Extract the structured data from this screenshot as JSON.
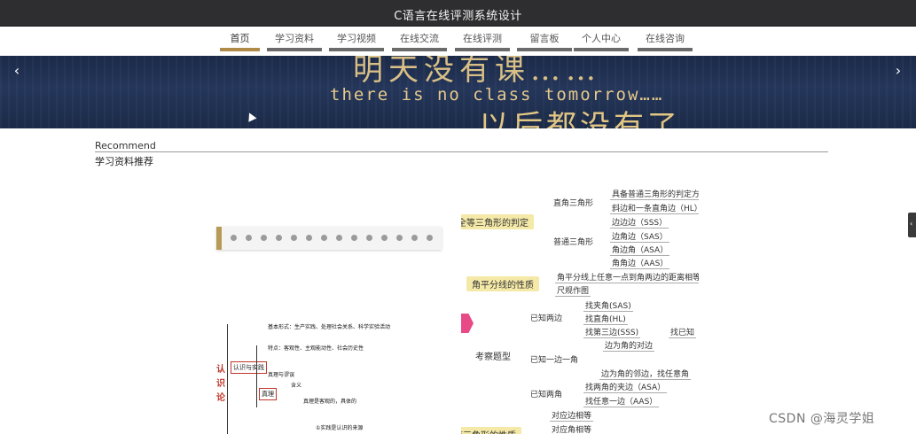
{
  "app": {
    "title": "C语言在线评测系统设计"
  },
  "nav": {
    "tabs": [
      {
        "label": "首页",
        "active": true
      },
      {
        "label": "学习资料",
        "active": false
      },
      {
        "label": "学习视频",
        "active": false
      },
      {
        "label": "在线交流",
        "active": false
      },
      {
        "label": "在线评测",
        "active": false
      },
      {
        "label": "留言板",
        "active": false
      },
      {
        "label": "个人中心",
        "active": false
      },
      {
        "label": "在线咨询",
        "active": false
      }
    ]
  },
  "banner": {
    "line1": "明天没有课……",
    "line2": "there is no class tomorrow……",
    "line3": "以后都没有了……",
    "prev_icon": "‹",
    "next_icon": "›"
  },
  "section": {
    "title_en": "Recommend",
    "title_cn": "学习资料推荐"
  },
  "mindmap_left": {
    "tag": "认识论",
    "box1": "认识与实践",
    "box2": "真理",
    "lines": [
      "基本形式：生产实践、处理社会关系、科学实验活动",
      "特点：客观性、主观能动性、社会历史性",
      "真理与谬误",
      "含义",
      "真理是客观的，具体的",
      "①实践是认识的来源"
    ]
  },
  "mindmap_right": {
    "topic1": "全等三角形的判定",
    "topic2": "角平分线的性质",
    "topic3": "考察题型",
    "topic4": "全等三角形的性质",
    "branch_right": "直角三角形",
    "branch_normal": "普通三角形",
    "leaf_r1": "具备普通三角形的判定方法",
    "leaf_r2": "斜边和一条直角边（HL）",
    "leaf_n1": "边边边（SSS）",
    "leaf_n2": "边角边（SAS）",
    "leaf_n3": "角边角（ASA）",
    "leaf_n4": "角角边（AAS）",
    "bisector1": "角平分线上任意一点到角两边的距离相等",
    "bisector2": "尺规作图",
    "known_two_sides": "已知两边",
    "find_angle": "找夹角(SAS)",
    "find_right": "找直角(HL)",
    "find_third": "找第三边(SSS)",
    "known_side_angle": "已知一边一角",
    "side_angle_1": "边为角的对边",
    "side_angle_2": "边为角的邻边，找任意角",
    "find_known": "找已知",
    "known_two_angles": "已知两角",
    "two_angle_1": "找两角的夹边（ASA）",
    "two_angle_2": "找任意一边（AAS）",
    "corr_side": "对应边相等",
    "corr_angle": "对应角相等"
  },
  "watermark": "CSDN @海灵学姐"
}
